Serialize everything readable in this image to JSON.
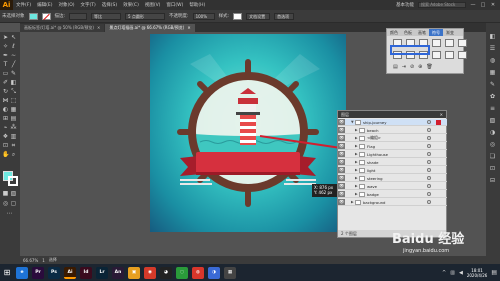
{
  "app": {
    "logo": "Ai",
    "menu": [
      "文件(F)",
      "编辑(E)",
      "对象(O)",
      "文字(T)",
      "选择(S)",
      "效果(C)",
      "视图(V)",
      "窗口(W)",
      "帮助(H)"
    ],
    "workspace": "基本功能",
    "search_placeholder": "搜索 Adobe Stock",
    "window_controls": [
      "—",
      "□",
      "✕"
    ]
  },
  "control_bar": {
    "selection_label": "未选择对象",
    "stroke_label": "描边:",
    "stroke_weight": "",
    "brush_label": "等比",
    "brush_size": "5 点圆形",
    "opacity_label": "不透明度:",
    "opacity_value": "100%",
    "style_label": "样式:",
    "doc_setup": "文档设置",
    "preferences": "首选项"
  },
  "tabs": [
    {
      "label": "画板标签/灯塔.ai* @ 50% (RGB/预览)",
      "close": "✕",
      "active": false
    },
    {
      "label": "景点灯塔插画.ai* @ 66.67% (RGB/预览)",
      "close": "✕",
      "active": true
    }
  ],
  "swatch_panel": {
    "tabs": [
      "颜色",
      "色板",
      "画笔",
      "符号",
      "渐变"
    ],
    "active_tab": "符号"
  },
  "layers_panel": {
    "title": "图层",
    "close": "✕",
    "rows": [
      {
        "name": "ship-journey",
        "level": 0,
        "expanded": true
      },
      {
        "name": "beach",
        "level": 1,
        "expanded": false
      },
      {
        "name": "<编组>",
        "level": 1,
        "expanded": false
      },
      {
        "name": "Flag",
        "level": 1,
        "expanded": false
      },
      {
        "name": "Lighthouse",
        "level": 1,
        "expanded": false
      },
      {
        "name": "shade",
        "level": 1,
        "expanded": false
      },
      {
        "name": "light",
        "level": 1,
        "expanded": false
      },
      {
        "name": "steering",
        "level": 1,
        "expanded": false
      },
      {
        "name": "wave",
        "level": 1,
        "expanded": false
      },
      {
        "name": "badge",
        "level": 1,
        "expanded": false
      },
      {
        "name": "background",
        "level": 0,
        "expanded": false
      }
    ],
    "footer": "2 个图层"
  },
  "tooltip": {
    "line1": "X: 876 px",
    "line2": "Y: 462 px"
  },
  "status_bar": {
    "zoom": "66.67%",
    "page": "1",
    "tool": "选择"
  },
  "taskbar": {
    "apps": [
      {
        "label": "e",
        "color": "#1e73d6"
      },
      {
        "label": "Pr",
        "color": "#2a0b3c"
      },
      {
        "label": "Ps",
        "color": "#0a2a44"
      },
      {
        "label": "Ai",
        "color": "#3a1a00"
      },
      {
        "label": "Id",
        "color": "#3b0b1e"
      },
      {
        "label": "Lr",
        "color": "#0a2436"
      },
      {
        "label": "An",
        "color": "#2a1a36"
      }
    ],
    "time": "18:01",
    "date": "2020/4/26"
  },
  "watermark": {
    "text": "Baidu 经验",
    "url": "jingyan.baidu.com"
  },
  "colors": {
    "fill_swatch": "#6ee8e0",
    "stroke_swatch": "#ffffff",
    "arrow": "#d21f2f"
  }
}
